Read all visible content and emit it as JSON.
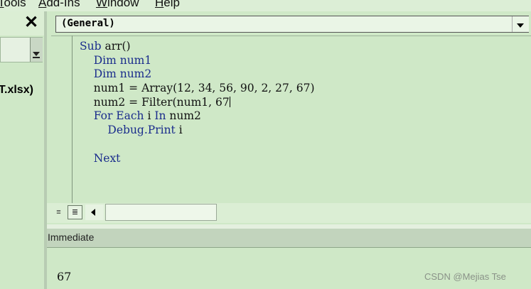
{
  "menubar": {
    "items": [
      {
        "prefix": "",
        "underline": "T",
        "rest": "ools"
      },
      {
        "prefix": "",
        "underline": "A",
        "rest": "dd-Ins"
      },
      {
        "prefix": "",
        "underline": "W",
        "rest": "indow"
      },
      {
        "prefix": "",
        "underline": "H",
        "rest": "elp"
      }
    ]
  },
  "project_pane": {
    "close_glyph": "✕",
    "file_label": "T.xlsx)"
  },
  "code_window": {
    "object_combo_value": "(General)",
    "lines": [
      [
        {
          "t": "Sub ",
          "k": true
        },
        {
          "t": "arr()",
          "k": false
        }
      ],
      [
        {
          "t": "    Dim ",
          "k": true
        },
        {
          "t": "num1",
          "k": true
        }
      ],
      [
        {
          "t": "    Dim ",
          "k": true
        },
        {
          "t": "num2",
          "k": true
        }
      ],
      [
        {
          "t": "    num1 = Array(12, 34, 56, 90, 2, 27, 67)",
          "k": false
        }
      ],
      [
        {
          "t": "    num2 = Filter(num1, 67",
          "k": false
        }
      ],
      [
        {
          "t": "    For Each ",
          "k": true
        },
        {
          "t": "i ",
          "k": false
        },
        {
          "t": "In ",
          "k": true
        },
        {
          "t": "num2",
          "k": false
        }
      ],
      [
        {
          "t": "        Debug.",
          "k": true
        },
        {
          "t": "Print ",
          "k": true
        },
        {
          "t": "i",
          "k": false
        }
      ],
      [
        {
          "t": "",
          "k": false
        }
      ],
      [
        {
          "t": "    Next",
          "k": true
        }
      ]
    ],
    "cursor_line": 4,
    "view_buttons": {
      "procedure": "≡",
      "full_module": "≣"
    }
  },
  "immediate": {
    "title": "Immediate",
    "output": "67"
  },
  "watermark": "CSDN @Mejias Tse"
}
